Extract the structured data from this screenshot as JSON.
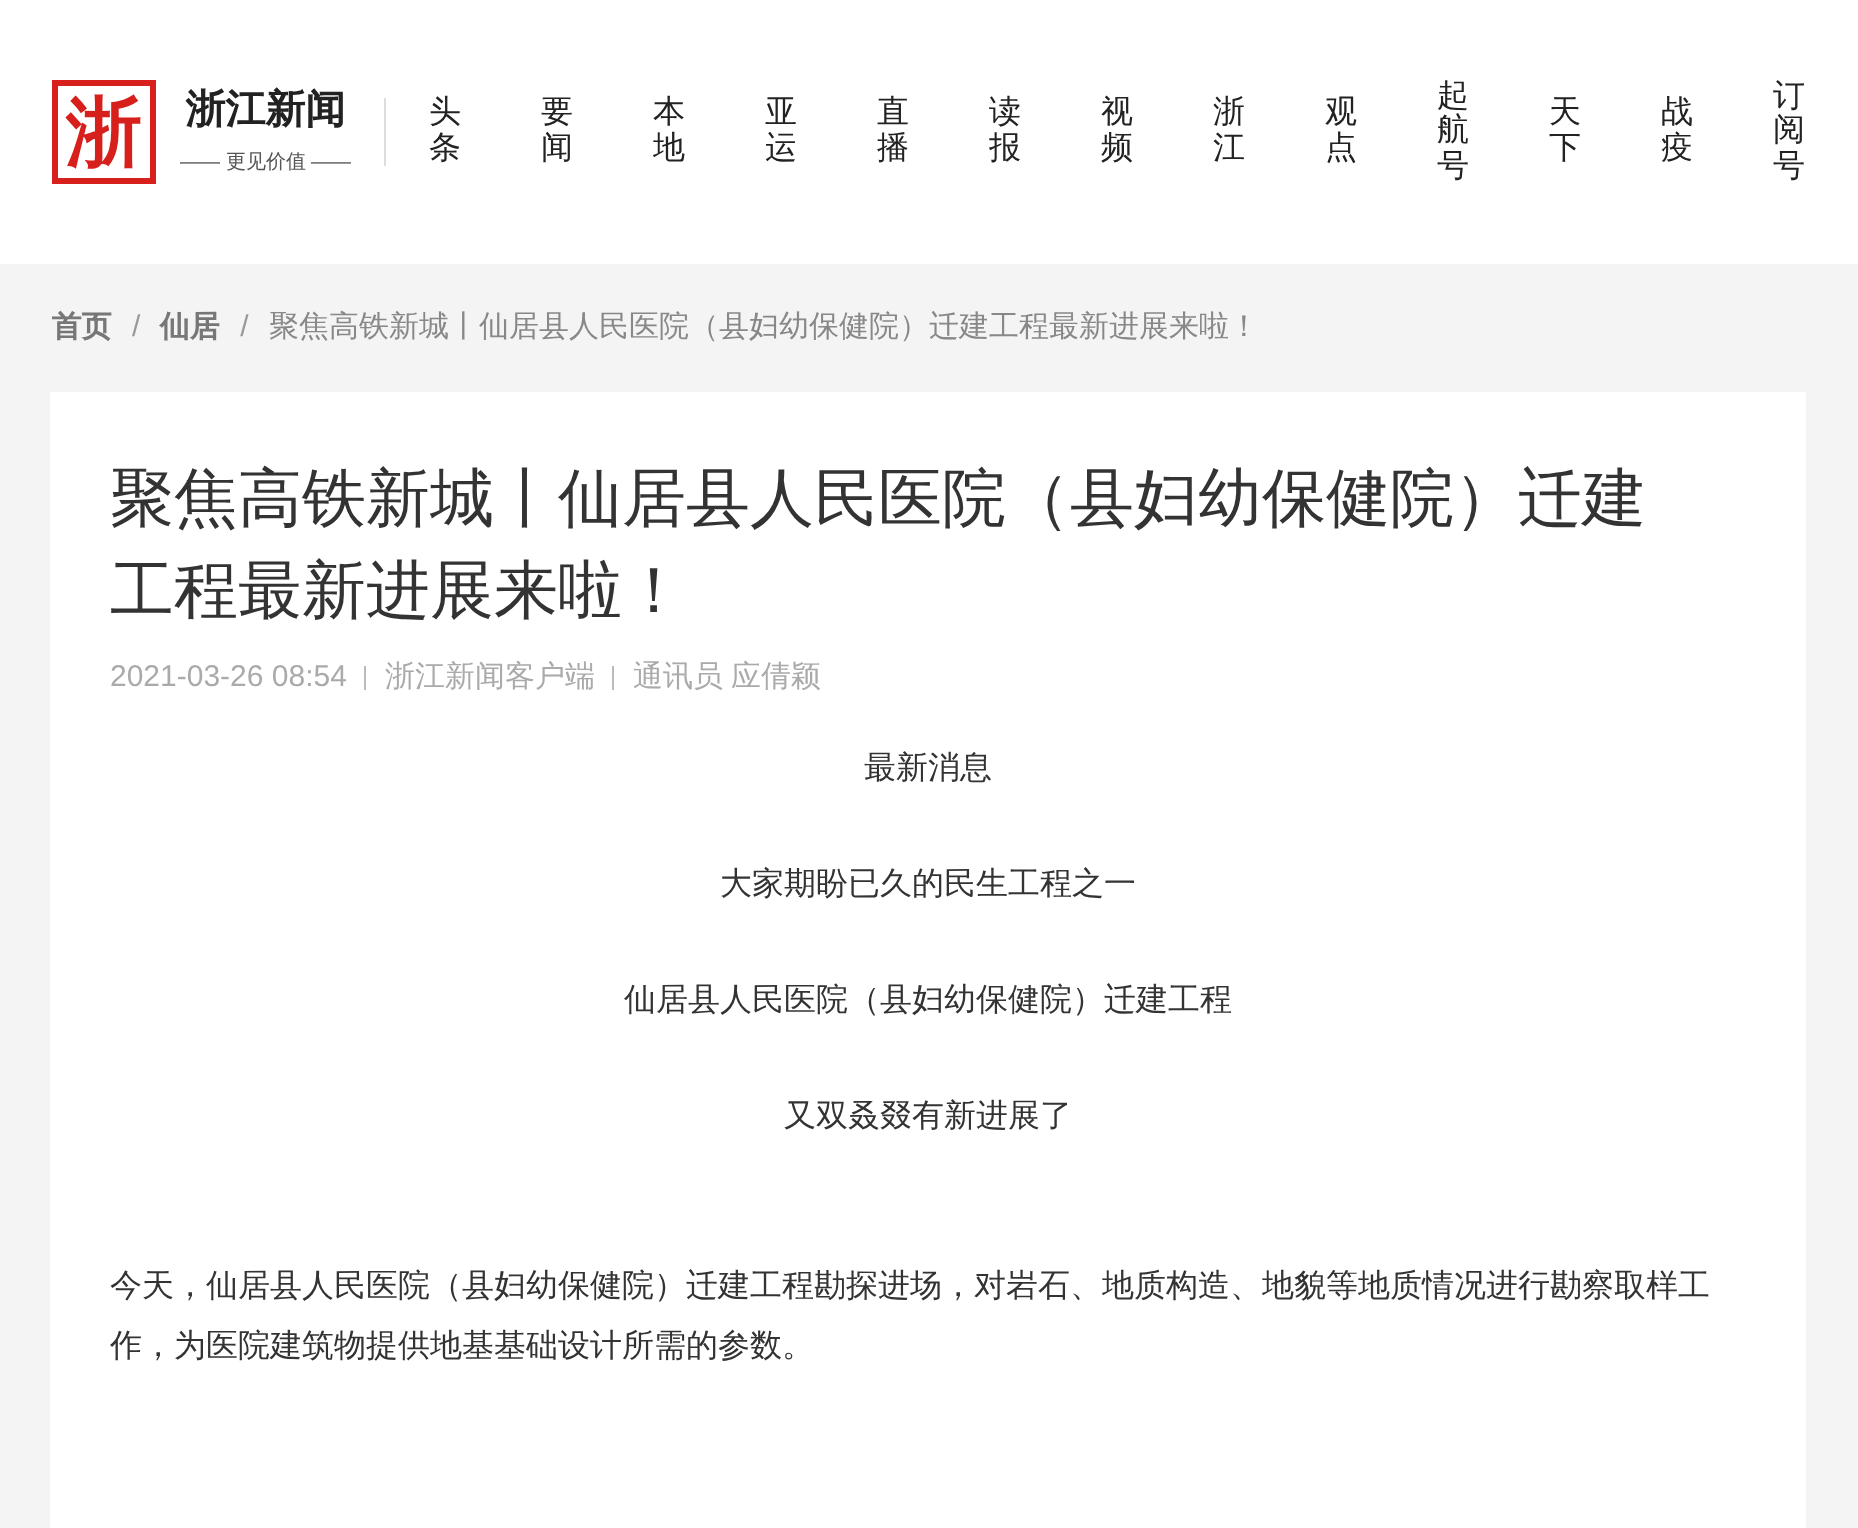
{
  "header": {
    "logo": {
      "mark": "浙",
      "name": "浙江新闻",
      "slogan": "—— 更见价值 ——"
    },
    "nav": [
      "头条",
      "要闻",
      "本地",
      "亚运",
      "直播",
      "读报",
      "视频",
      "浙江",
      "观点",
      "起航号",
      "天下",
      "战疫",
      "订阅号"
    ]
  },
  "breadcrumb_separator": "/",
  "breadcrumb": [
    {
      "label": "首页",
      "kind": "link"
    },
    {
      "label": "仙居",
      "kind": "link"
    },
    {
      "label": "聚焦高铁新城丨仙居县人民医院（县妇幼保健院）迁建工程最新进展来啦！",
      "kind": "current"
    }
  ],
  "article": {
    "title": "聚焦高铁新城丨仙居县人民医院（县妇幼保健院）迁建工程最新进展来啦！",
    "meta": [
      "2021-03-26 08:54",
      "浙江新闻客户端",
      "通讯员 应倩颖"
    ],
    "paragraphs": [
      {
        "text": "最新消息",
        "kind": "centered"
      },
      {
        "text": "大家期盼已久的民生工程之一",
        "kind": "centered"
      },
      {
        "text": "仙居县人民医院（县妇幼保健院）迁建工程",
        "kind": "centered"
      },
      {
        "text": "又双叒叕有新进展了",
        "kind": "centered"
      },
      {
        "text": "今天，仙居县人民医院（县妇幼保健院）迁建工程勘探进场，对岩石、地质构造、地貌等地质情况进行勘察取样工作，为医院建筑物提供地基基础设计所需的参数。",
        "kind": "body"
      }
    ]
  }
}
